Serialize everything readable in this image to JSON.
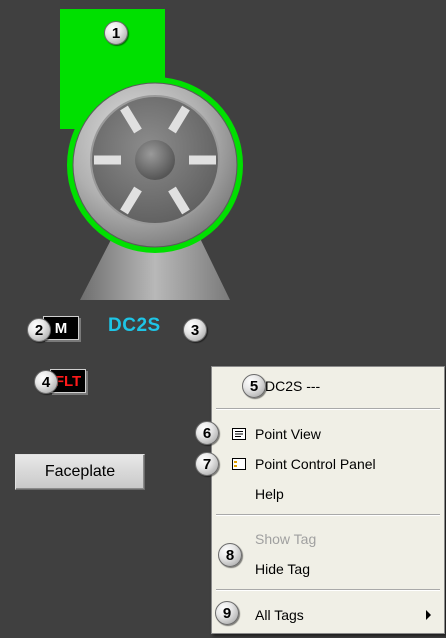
{
  "colors": {
    "background": "#404040",
    "running_green": "#00e000",
    "tag_cyan": "#1ec5e6",
    "fault_red": "#ff1a1a",
    "menu_bg": "#f0efe6"
  },
  "equipment": {
    "symbol": "fan-symbol",
    "mode": "M",
    "tag": "DC2S",
    "fault": "FLT",
    "faceplate_label": "Faceplate"
  },
  "callouts": [
    "1",
    "2",
    "3",
    "4",
    "5",
    "6",
    "7",
    "8",
    "9"
  ],
  "context_menu": {
    "header": "DC2S ---",
    "items": {
      "point_view": {
        "label": "Point View",
        "icon": "point-view-icon"
      },
      "point_control_panel": {
        "label": "Point Control Panel",
        "icon": "control-panel-icon"
      },
      "help": {
        "label": "Help"
      },
      "show_tag": {
        "label": "Show Tag",
        "enabled": false
      },
      "hide_tag": {
        "label": "Hide Tag"
      },
      "all_tags": {
        "label": "All Tags",
        "has_submenu": true
      }
    }
  }
}
